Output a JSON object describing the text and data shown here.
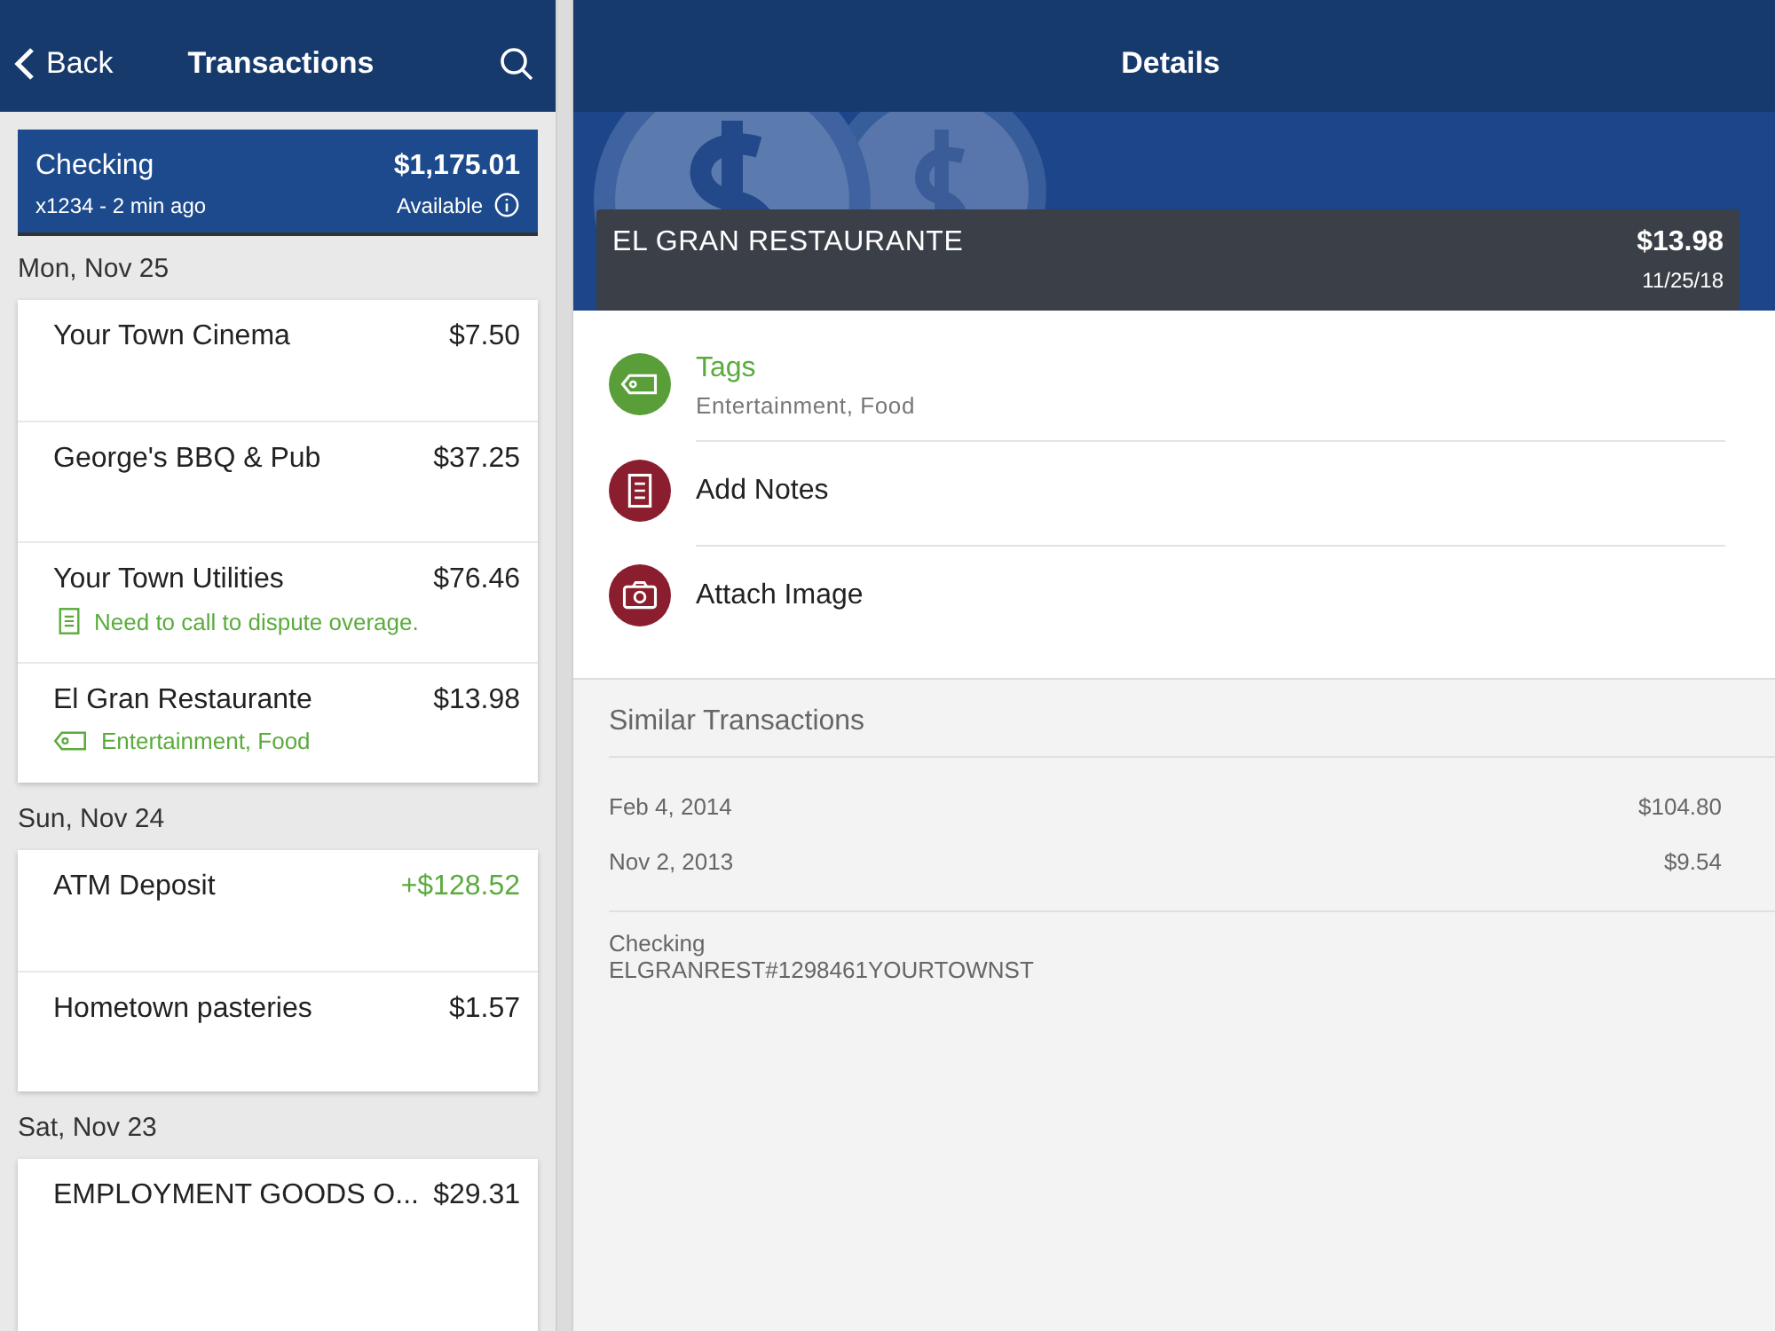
{
  "header": {
    "back": "Back",
    "left_title": "Transactions",
    "right_title": "Details"
  },
  "account": {
    "name": "Checking",
    "balance": "$1,175.01",
    "subtitle": "x1234 - 2 min ago",
    "balance_label": "Available"
  },
  "days": [
    {
      "date": "Mon, Nov 25",
      "transactions": [
        {
          "name": "Your Town Cinema",
          "amount": "$7.50",
          "credit": false
        },
        {
          "name": "George's BBQ & Pub",
          "amount": "$37.25",
          "credit": false
        },
        {
          "name": "Your Town Utilities",
          "amount": "$76.46",
          "credit": false,
          "note": {
            "kind": "note",
            "text": "Need to call to dispute overage."
          }
        },
        {
          "name": "El Gran Restaurante",
          "amount": "$13.98",
          "credit": false,
          "note": {
            "kind": "tag",
            "text": "Entertainment, Food"
          }
        }
      ]
    },
    {
      "date": "Sun, Nov 24",
      "transactions": [
        {
          "name": "ATM Deposit",
          "amount": "+$128.52",
          "credit": true
        },
        {
          "name": "Hometown pasteries",
          "amount": "$1.57",
          "credit": false
        }
      ]
    },
    {
      "date": "Sat, Nov 23",
      "transactions": [
        {
          "name": "EMPLOYMENT GOODS O...",
          "amount": "$29.31",
          "credit": false
        }
      ]
    }
  ],
  "detail": {
    "merchant": "EL GRAN RESTAURANTE",
    "amount": "$13.98",
    "date": "11/25/18",
    "actions": [
      {
        "kind": "tag",
        "label": "Tags",
        "subtitle": "Entertainment, Food",
        "color": "#5a9e3a",
        "highlight": true
      },
      {
        "kind": "notes",
        "label": "Add Notes",
        "color": "#8b1e2e",
        "highlight": false
      },
      {
        "kind": "camera",
        "label": "Attach Image",
        "color": "#8b1e2e",
        "highlight": false
      }
    ],
    "similar_title": "Similar Transactions",
    "similar": [
      {
        "date": "Feb 4, 2014",
        "amount": "$104.80"
      },
      {
        "date": "Nov 2, 2013",
        "amount": "$9.54"
      }
    ],
    "account": "Checking",
    "description": "ELGRANREST#1298461YOURTOWNST"
  }
}
